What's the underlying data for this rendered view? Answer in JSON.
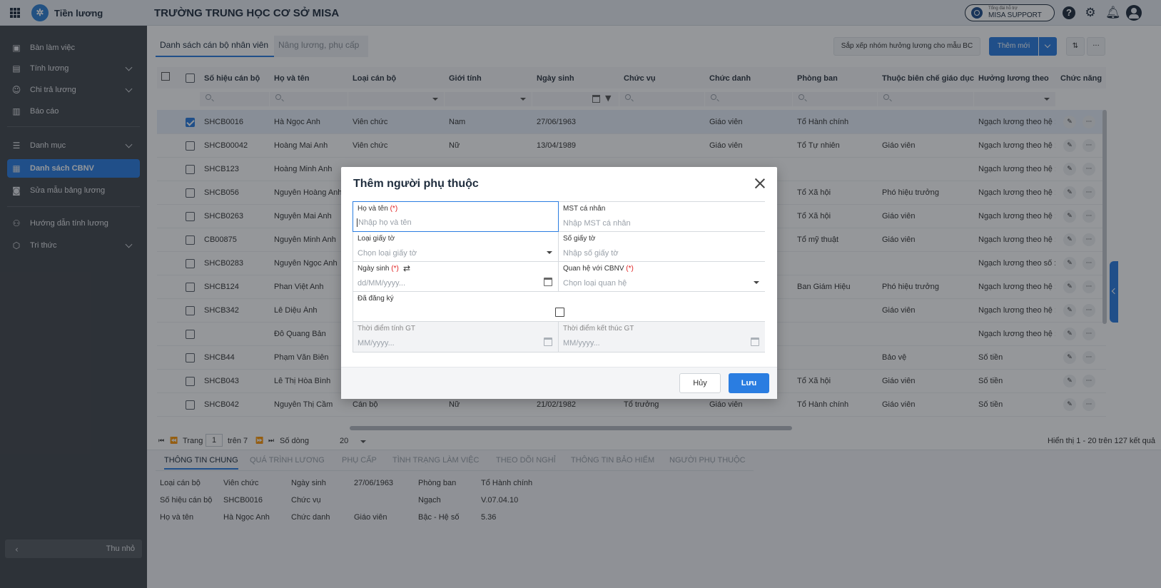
{
  "app": {
    "name": "Tiền lương",
    "org_title": "TRƯỜNG TRUNG HỌC CƠ SỞ MISA",
    "support_small": "Tổng đài hỗ trợ",
    "support_label": "MISA SUPPORT"
  },
  "sidebar": {
    "items": [
      {
        "label": "Bàn làm việc",
        "icon": "desk-icon"
      },
      {
        "label": "Tính lương",
        "icon": "calculator-icon"
      },
      {
        "label": "Chi trả lương",
        "icon": "payment-icon"
      },
      {
        "label": "Báo cáo",
        "icon": "report-icon"
      },
      {
        "label": "Danh mục",
        "icon": "list-icon"
      },
      {
        "label": "Danh sách CBNV",
        "icon": "id-card-icon"
      },
      {
        "label": "Sửa mẫu bảng lương",
        "icon": "edit-template-icon"
      },
      {
        "label": "Hướng dẫn tính lương",
        "icon": "guide-icon"
      },
      {
        "label": "Tri thức",
        "icon": "knowledge-icon"
      }
    ],
    "collapse_label": "Thu nhỏ"
  },
  "tabs": [
    "Danh sách cán bộ nhân viên",
    "Nâng lương, phụ cấp"
  ],
  "toolbar": {
    "sort_label": "Sắp xếp nhóm hưởng lương cho mẫu BC",
    "add_label": "Thêm mới",
    "more_label": "···"
  },
  "grid": {
    "headers": [
      "Số hiệu cán bộ",
      "Họ và tên",
      "Loại cán bộ",
      "Giới tính",
      "Ngày sinh",
      "Chức vụ",
      "Chức danh",
      "Phòng ban",
      "Thuộc biên chế giáo dục",
      "Hưởng lương theo",
      "Chức năng"
    ],
    "rows": [
      {
        "checked": true,
        "code": "SHCB0016",
        "name": "Hà Ngọc Anh",
        "type": "Viên chức",
        "gender": "Nam",
        "dob": "27/06/1963",
        "position": "",
        "title": "Giáo viên",
        "dept": "Tổ Hành chính",
        "staff": "",
        "salary": "Ngạch lương theo hệ :"
      },
      {
        "checked": false,
        "code": "SHCB00042",
        "name": "Hoàng Mai Anh",
        "type": "Viên chức",
        "gender": "Nữ",
        "dob": "13/04/1989",
        "position": "",
        "title": "Giáo viên",
        "dept": "Tổ Tự nhiên",
        "staff": "Giáo viên",
        "salary": "Ngạch lương theo hệ :"
      },
      {
        "checked": false,
        "code": "SHCB123",
        "name": "Hoàng Minh Anh",
        "type": "",
        "gender": "",
        "dob": "",
        "position": "",
        "title": "",
        "dept": "",
        "staff": "",
        "salary": "Ngạch lương theo hệ :"
      },
      {
        "checked": false,
        "code": "SHCB056",
        "name": "Nguyễn Hoàng Anh",
        "type": "",
        "gender": "",
        "dob": "",
        "position": "",
        "title": "",
        "dept": "Tổ Xã hội",
        "staff": "Phó hiệu trưởng",
        "salary": "Ngạch lương theo hệ :"
      },
      {
        "checked": false,
        "code": "SHCB0263",
        "name": "Nguyễn Mai Anh",
        "type": "",
        "gender": "",
        "dob": "",
        "position": "",
        "title": "",
        "dept": "Tổ Xã hội",
        "staff": "Giáo viên",
        "salary": "Ngạch lương theo hệ :"
      },
      {
        "checked": false,
        "code": "CB00875",
        "name": "Nguyễn Minh Anh",
        "type": "",
        "gender": "",
        "dob": "",
        "position": "",
        "title": "",
        "dept": "Tổ mỹ thuật",
        "staff": "Giáo viên",
        "salary": "Ngạch lương theo hệ :"
      },
      {
        "checked": false,
        "code": "SHCB0283",
        "name": "Nguyễn Ngọc Anh",
        "type": "",
        "gender": "",
        "dob": "",
        "position": "",
        "title": "",
        "dept": "",
        "staff": "",
        "salary": "Ngạch lương theo số :"
      },
      {
        "checked": false,
        "code": "SHCB124",
        "name": "Phan Việt Anh",
        "type": "",
        "gender": "",
        "dob": "",
        "position": "",
        "title": "",
        "dept": "Ban Giám Hiệu",
        "staff": "Phó hiệu trưởng",
        "salary": "Ngạch lương theo hệ :"
      },
      {
        "checked": false,
        "code": "SHCB342",
        "name": "Lê Diệu Ánh",
        "type": "",
        "gender": "",
        "dob": "",
        "position": "",
        "title": "",
        "dept": "",
        "staff": "Giáo viên",
        "salary": "Ngạch lương theo hệ :"
      },
      {
        "checked": false,
        "code": "",
        "name": "Đỗ Quang Bản",
        "type": "",
        "gender": "",
        "dob": "",
        "position": "",
        "title": "",
        "dept": "",
        "staff": "",
        "salary": "Ngạch lương theo hệ :"
      },
      {
        "checked": false,
        "code": "SHCB44",
        "name": "Phạm Văn Biên",
        "type": "",
        "gender": "",
        "dob": "",
        "position": "",
        "title": "",
        "dept": "",
        "staff": "Bảo vệ",
        "salary": "Số tiền"
      },
      {
        "checked": false,
        "code": "SHCB043",
        "name": "Lê Thị Hòa Bình",
        "type": "",
        "gender": "",
        "dob": "",
        "position": "",
        "title": "",
        "dept": "Tổ Xã hội",
        "staff": "Giáo viên",
        "salary": "Số tiền"
      },
      {
        "checked": false,
        "code": "SHCB042",
        "name": "Nguyễn Thị Cầm",
        "type": "Cán bộ",
        "gender": "Nữ",
        "dob": "21/02/1982",
        "position": "Tổ trưởng",
        "title": "Giáo viên",
        "dept": "Tổ Hành chính",
        "staff": "Giáo viên",
        "salary": "Số tiền"
      }
    ]
  },
  "pager": {
    "page_label": "Trang",
    "page": "1",
    "of_label": "trên 7",
    "rows_label": "Số dòng",
    "rows": "20",
    "summary": "Hiển thị 1 - 20 trên 127 kết quả"
  },
  "detail": {
    "tabs": [
      "THÔNG TIN CHUNG",
      "QUÁ TRÌNH LƯƠNG",
      "PHỤ CẤP",
      "TÌNH TRẠNG LÀM VIỆC",
      "THEO DÕI NGHỈ",
      "THÔNG TIN BẢO HIỂM",
      "NGƯỜI PHỤ THUỘC"
    ],
    "fields": {
      "type_k": "Loại cán bộ",
      "type_v": "Viên chức",
      "code_k": "Số hiệu cán bộ",
      "code_v": "SHCB0016",
      "name_k": "Họ và tên",
      "name_v": "Hà Ngọc Anh",
      "dob_k": "Ngày sinh",
      "dob_v": "27/06/1963",
      "pos_k": "Chức vụ",
      "pos_v": "",
      "title_k": "Chức danh",
      "title_v": "Giáo viên",
      "dept_k": "Phòng ban",
      "dept_v": "Tổ Hành chính",
      "grade_k": "Ngạch",
      "grade_v": "V.07.04.10",
      "coef_k": "Bậc - Hệ số",
      "coef_v": "5.36"
    }
  },
  "dialog": {
    "title": "Thêm người phụ thuộc",
    "required_mark": "(*)",
    "fullname_label": "Họ và tên",
    "fullname_ph": "Nhập họ và tên",
    "tax_label": "MST cá nhân",
    "tax_ph": "Nhập MST cá nhân",
    "doctype_label": "Loại giấy tờ",
    "doctype_ph": "Chọn loại giấy tờ",
    "docno_label": "Số giấy tờ",
    "docno_ph": "Nhập số giấy tờ",
    "dob_label": "Ngày sinh",
    "dob_ph": "dd/MM/yyyy...",
    "relation_label": "Quan hệ với CBNV",
    "relation_ph": "Chọn loại quan hệ",
    "registered_label": "Đã đăng ký",
    "start_label": "Thời điểm tính GT",
    "start_ph": "MM/yyyy...",
    "end_label": "Thời điểm kết thúc GT",
    "end_ph": "MM/yyyy...",
    "cancel_label": "Hủy",
    "save_label": "Lưu"
  }
}
